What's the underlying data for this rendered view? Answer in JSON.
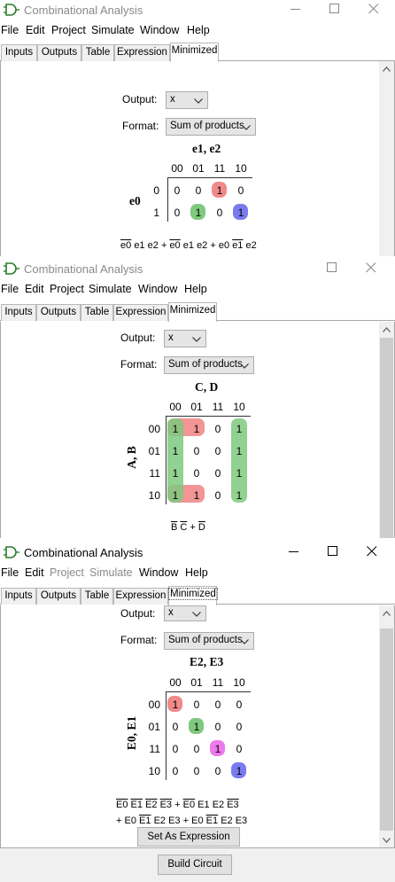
{
  "colors": {
    "red": "#f08a8a",
    "green": "#7ec97e",
    "blue": "#7a7af0",
    "magenta": "#ec7aec"
  },
  "windows": [
    {
      "title": "Combinational Analysis",
      "menu": [
        "File",
        "Edit",
        "Project",
        "Simulate",
        "Window",
        "Help"
      ],
      "tabs": [
        "Inputs",
        "Outputs",
        "Table",
        "Expression",
        "Minimized"
      ],
      "output_label": "Output:",
      "output_value": "x",
      "format_label": "Format:",
      "format_value": "Sum of products",
      "kmap": {
        "col_vars": "e1, e2",
        "row_vars": "e0",
        "col_headers": [
          "00",
          "01",
          "11",
          "10"
        ],
        "row_headers": [
          "0",
          "1"
        ],
        "cells": [
          [
            "0",
            "0",
            "1",
            "0"
          ],
          [
            "0",
            "1",
            "0",
            "1"
          ]
        ]
      },
      "expression": "e0 e1 e2 + e0 e1 e2 + e0 e1 e2"
    },
    {
      "title": "Combinational Analysis",
      "menu": [
        "File",
        "Edit",
        "Project",
        "Simulate",
        "Window",
        "Help"
      ],
      "tabs": [
        "Inputs",
        "Outputs",
        "Table",
        "Expression",
        "Minimized"
      ],
      "output_label": "Output:",
      "output_value": "x",
      "format_label": "Format:",
      "format_value": "Sum of products",
      "kmap": {
        "col_vars": "C, D",
        "row_vars": "A, B",
        "col_headers": [
          "00",
          "01",
          "11",
          "10"
        ],
        "row_headers": [
          "00",
          "01",
          "11",
          "10"
        ],
        "cells": [
          [
            "1",
            "1",
            "0",
            "1"
          ],
          [
            "1",
            "0",
            "0",
            "1"
          ],
          [
            "1",
            "0",
            "0",
            "1"
          ],
          [
            "1",
            "1",
            "0",
            "1"
          ]
        ]
      },
      "expression": "B C + D"
    },
    {
      "title": "Combinational Analysis",
      "menu": [
        "File",
        "Edit",
        "Project",
        "Simulate",
        "Window",
        "Help"
      ],
      "tabs": [
        "Inputs",
        "Outputs",
        "Table",
        "Expression",
        "Minimized"
      ],
      "output_label": "Output:",
      "output_value": "x",
      "format_label": "Format:",
      "format_value": "Sum of products",
      "kmap": {
        "col_vars": "E2, E3",
        "row_vars": "E0, E1",
        "col_headers": [
          "00",
          "01",
          "11",
          "10"
        ],
        "row_headers": [
          "00",
          "01",
          "11",
          "10"
        ],
        "cells": [
          [
            "1",
            "0",
            "0",
            "0"
          ],
          [
            "0",
            "1",
            "0",
            "0"
          ],
          [
            "0",
            "0",
            "1",
            "0"
          ],
          [
            "0",
            "0",
            "0",
            "1"
          ]
        ]
      },
      "expression_line1": "E0 E1 E2 E3 + E0 E1 E2 E3",
      "expression_line2": "+ E0 E1 E2 E3 + E0 E1 E2 E3",
      "set_expression_button": "Set As Expression",
      "build_circuit_button": "Build Circuit"
    }
  ]
}
